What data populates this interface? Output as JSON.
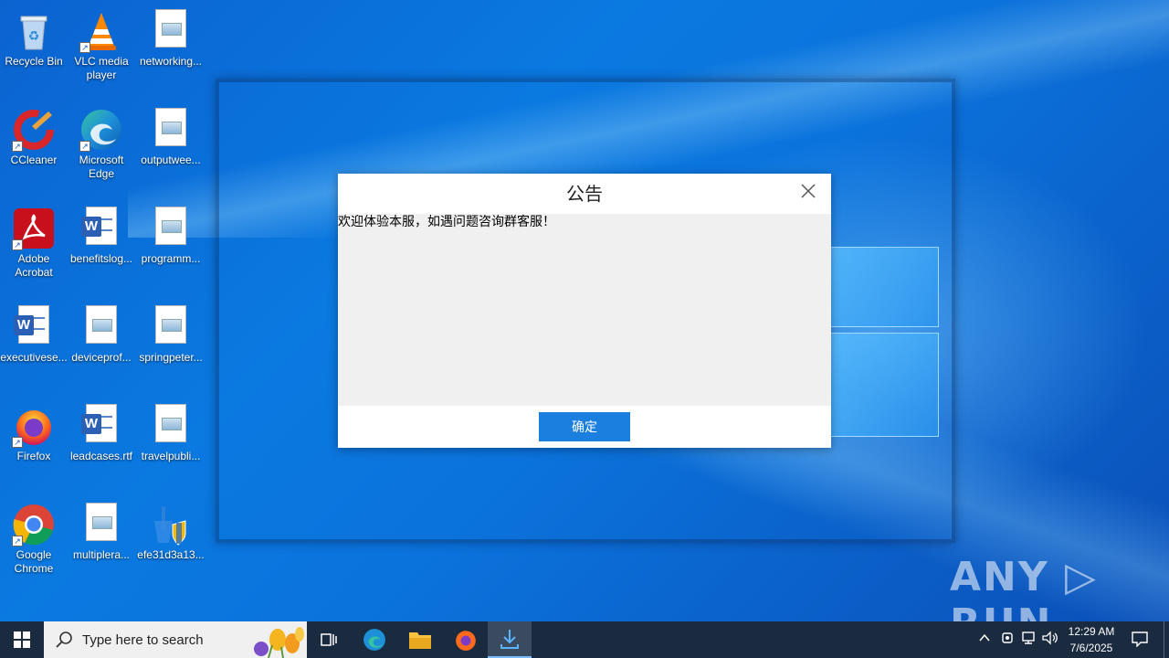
{
  "desktop": {
    "icons": [
      {
        "label": "Recycle Bin"
      },
      {
        "label": "VLC media player"
      },
      {
        "label": "networking..."
      },
      {
        "label": "CCleaner"
      },
      {
        "label": "Microsoft Edge"
      },
      {
        "label": "outputwee..."
      },
      {
        "label": "Adobe Acrobat"
      },
      {
        "label": "benefitslog..."
      },
      {
        "label": "programm..."
      },
      {
        "label": "executivese..."
      },
      {
        "label": "deviceprof..."
      },
      {
        "label": "springpeter..."
      },
      {
        "label": "Firefox"
      },
      {
        "label": "leadcases.rtf"
      },
      {
        "label": "travelpubli..."
      },
      {
        "label": "Google Chrome"
      },
      {
        "label": "multiplera..."
      },
      {
        "label": "efe31d3a13..."
      }
    ]
  },
  "dialog": {
    "title": "公告",
    "message": "欢迎体验本服，如遇问题咨询群客服！",
    "ok_label": "确定"
  },
  "watermark": "ANY ▷ RUN",
  "taskbar": {
    "search_placeholder": "Type here to search",
    "time": "12:29 AM",
    "date": "7/6/2025"
  }
}
